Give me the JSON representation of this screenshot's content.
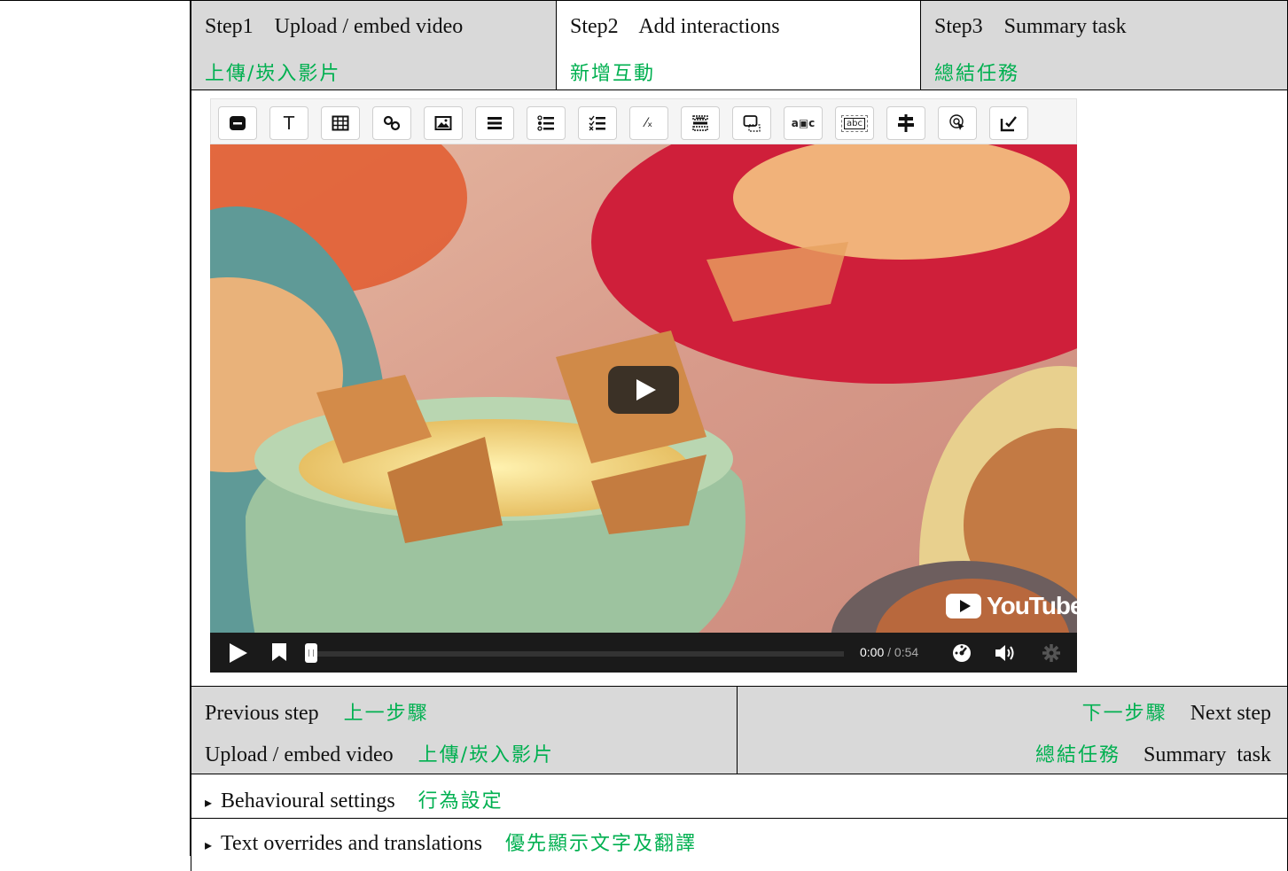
{
  "steps": [
    {
      "label_en": "Step1    Upload / embed video",
      "label_zh": "上傳/崁入影片",
      "active": false
    },
    {
      "label_en": "Step2    Add interactions",
      "label_zh": "新增互動",
      "active": true
    },
    {
      "label_en": "Step3    Summary task",
      "label_zh": "總結任務",
      "active": false
    }
  ],
  "toolbar": {
    "buttons": [
      {
        "name": "label-icon"
      },
      {
        "name": "text-icon",
        "glyph": "T"
      },
      {
        "name": "table-icon"
      },
      {
        "name": "link-icon"
      },
      {
        "name": "image-icon"
      },
      {
        "name": "statements-icon"
      },
      {
        "name": "single-choice-icon"
      },
      {
        "name": "multiple-choice-icon"
      },
      {
        "name": "true-false-icon",
        "glyph": "⁄ₓ"
      },
      {
        "name": "fill-blanks-icon"
      },
      {
        "name": "drag-drop-icon"
      },
      {
        "name": "mark-words-icon",
        "glyph": "a▣c"
      },
      {
        "name": "drag-text-icon",
        "glyph": "abc"
      },
      {
        "name": "crossroads-icon"
      },
      {
        "name": "navigation-hotspot-icon"
      },
      {
        "name": "free-text-question-icon"
      }
    ]
  },
  "video": {
    "time_current": "0:00",
    "time_total": "/ 0:54",
    "brand": "YouTube",
    "progress": 0.0
  },
  "nav": {
    "prev_label_en": "Previous step",
    "prev_label_zh": "上一步驟",
    "prev_target_en": "Upload / embed video",
    "prev_target_zh": "上傳/崁入影片",
    "next_label_zh": "下一步驟",
    "next_label_en": "Next step",
    "next_target_zh": "總結任務",
    "next_target_en": "Summary  task"
  },
  "sections": [
    {
      "label_en": "Behavioural settings",
      "label_zh": "行為設定"
    },
    {
      "label_en": "Text overrides and translations",
      "label_zh": "優先顯示文字及翻譯"
    }
  ]
}
